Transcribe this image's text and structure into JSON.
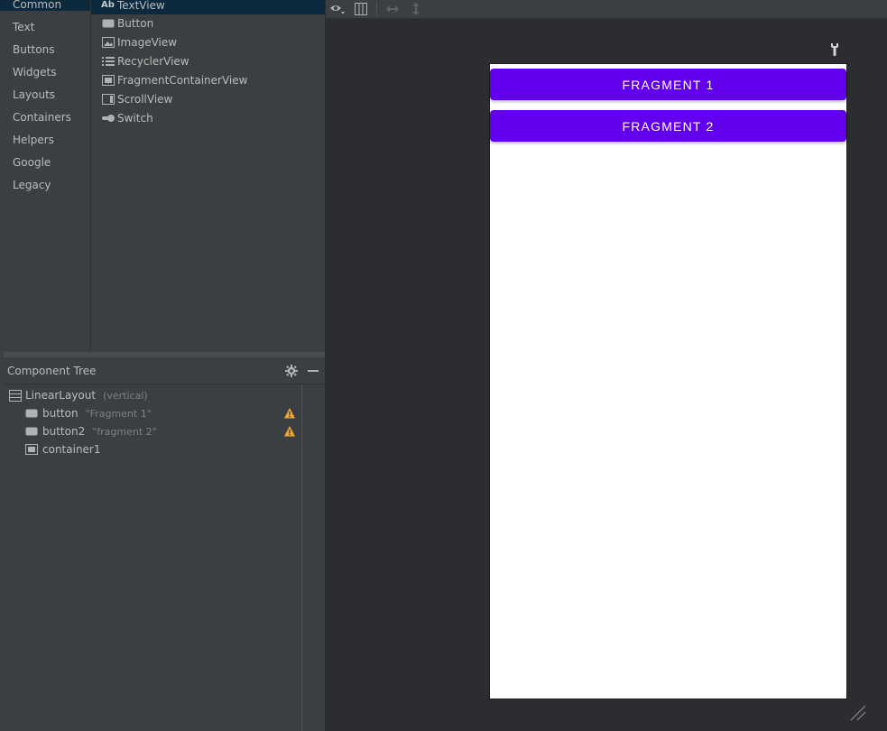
{
  "palette": {
    "categories": [
      {
        "label": "Common",
        "selected": true
      },
      {
        "label": "Text"
      },
      {
        "label": "Buttons"
      },
      {
        "label": "Widgets"
      },
      {
        "label": "Layouts"
      },
      {
        "label": "Containers"
      },
      {
        "label": "Helpers"
      },
      {
        "label": "Google"
      },
      {
        "label": "Legacy"
      }
    ],
    "items": [
      {
        "label": "TextView",
        "icon": "textview-icon",
        "icon_glyph": "Ab",
        "selected": true
      },
      {
        "label": "Button",
        "icon": "button-icon"
      },
      {
        "label": "ImageView",
        "icon": "imageview-icon"
      },
      {
        "label": "RecyclerView",
        "icon": "recyclerview-icon"
      },
      {
        "label": "FragmentContainerView",
        "icon": "fragmentcontainerview-icon"
      },
      {
        "label": "ScrollView",
        "icon": "scrollview-icon"
      },
      {
        "label": "Switch",
        "icon": "switch-icon"
      }
    ]
  },
  "component_tree": {
    "title": "Component Tree",
    "nodes": [
      {
        "name": "LinearLayout",
        "hint": "(vertical)",
        "icon": "linearlayout-icon",
        "warning": false
      },
      {
        "name": "button",
        "hint": "\"Fragment 1\"",
        "icon": "button-icon",
        "warning": true
      },
      {
        "name": "button2",
        "hint": "\"fragment 2\"",
        "icon": "button-icon",
        "warning": true
      },
      {
        "name": "container1",
        "hint": "",
        "icon": "fragmentcontainer-icon",
        "warning": false
      }
    ]
  },
  "design": {
    "toolbar_icons": [
      "eye-icon",
      "layout-columns-icon",
      "horizontal-resize-icon",
      "vertical-resize-icon"
    ],
    "buttons": [
      {
        "label": "FRAGMENT 1"
      },
      {
        "label": "FRAGMENT 2"
      }
    ]
  },
  "colors": {
    "accent": "#6200ee",
    "panel": "#3c3f41",
    "canvas": "#2b2d30",
    "selection": "#0d293e",
    "warning": "#f0a732"
  }
}
